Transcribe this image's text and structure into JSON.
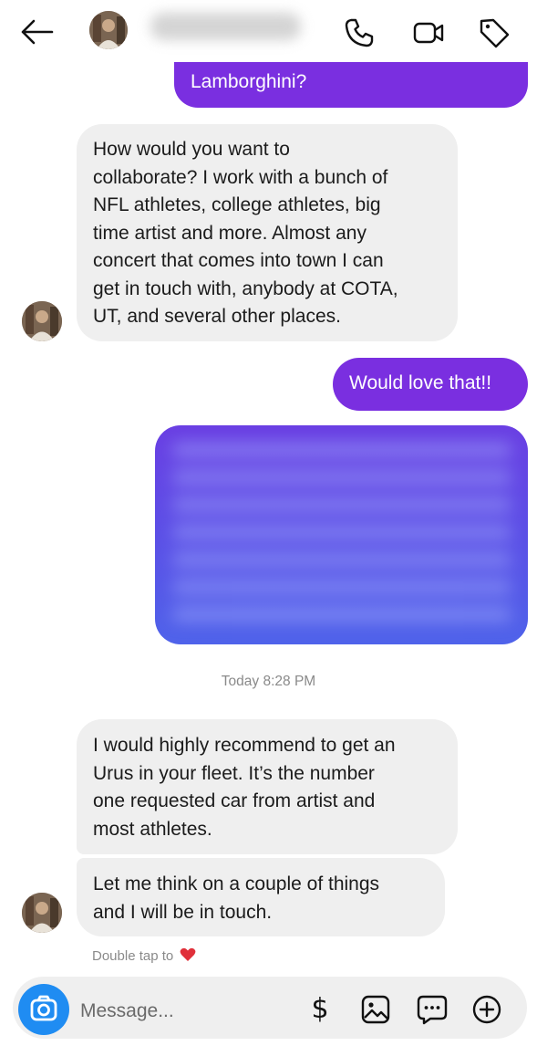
{
  "header": {
    "back_icon": "arrow-left-icon",
    "contact_name": "",
    "actions": [
      "phone-icon",
      "video-icon",
      "tag-icon"
    ]
  },
  "messages": [
    {
      "from": "me",
      "text": "Lamborghini?"
    },
    {
      "from": "them",
      "text": "How would you want to\ncollaborate? I work with a bunch of\nNFL athletes, college athletes, big\ntime artist and more. Almost any\nconcert that comes into town I can\nget in touch with, anybody at COTA,\nUT, and several other places."
    },
    {
      "from": "me",
      "text": "Would love that!!"
    },
    {
      "from": "me",
      "text": "",
      "redacted": true
    },
    {
      "from": "them",
      "text": "I would highly recommend to get an\nUrus in your fleet. It’s the number\none requested car from artist and\nmost athletes."
    },
    {
      "from": "them",
      "text": "Let me think on a couple of things\nand I will be in touch."
    }
  ],
  "timestamp": "Today 8:28 PM",
  "hint": {
    "text": "Double tap to",
    "icon": "heart-icon"
  },
  "composer": {
    "placeholder": "Message...",
    "camera_icon": "camera-icon",
    "dollar_label": "$",
    "icons": [
      "image-icon",
      "sticker-chat-icon",
      "plus-circle-icon"
    ]
  },
  "colors": {
    "outgoing": "#7a2fe0",
    "incoming": "#efefef",
    "camera": "#1f8cf2",
    "heart": "#e0303a"
  }
}
